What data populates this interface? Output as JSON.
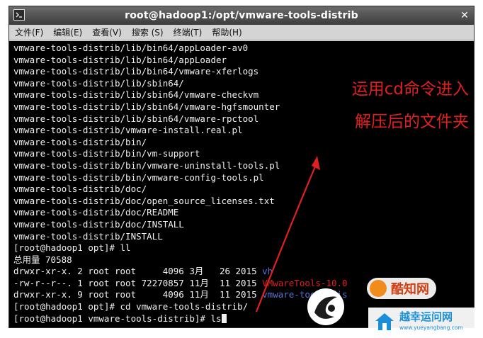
{
  "window": {
    "title": "root@hadoop1:/opt/vmware-tools-distrib",
    "close_glyph": "✕"
  },
  "menu": {
    "items": [
      {
        "label": "文件(F)"
      },
      {
        "label": "编辑(E)"
      },
      {
        "label": "查看(V)"
      },
      {
        "label": "搜索 (S)"
      },
      {
        "label": "终端(T)"
      },
      {
        "label": "帮助(H)"
      }
    ]
  },
  "terminal": {
    "lines": [
      "vmware-tools-distrib/lib/bin64/appLoader-av0",
      "vmware-tools-distrib/lib/bin64/appLoader",
      "vmware-tools-distrib/lib/bin64/vmware-xferlogs",
      "vmware-tools-distrib/lib/sbin64/",
      "vmware-tools-distrib/lib/sbin64/vmware-checkvm",
      "vmware-tools-distrib/lib/sbin64/vmware-hgfsmounter",
      "vmware-tools-distrib/lib/sbin64/vmware-rpctool",
      "vmware-tools-distrib/vmware-install.real.pl",
      "vmware-tools-distrib/bin/",
      "vmware-tools-distrib/bin/vm-support",
      "vmware-tools-distrib/bin/vmware-uninstall-tools.pl",
      "vmware-tools-distrib/bin/vmware-config-tools.pl",
      "vmware-tools-distrib/doc/",
      "vmware-tools-distrib/doc/open_source_licenses.txt",
      "vmware-tools-distrib/doc/README",
      "vmware-tools-distrib/doc/INSTALL",
      "vmware-tools-distrib/INSTALL",
      "[root@hadoop1 opt]# ll",
      "总用量 70588"
    ],
    "listing": [
      {
        "prefix": "drwxr-xr-x. 2 root root     4096 3月   26 2015 ",
        "name": "vh",
        "color": "blue"
      },
      {
        "prefix": "-rw-r--r--. 1 root root 72270857 11月  11 2015 ",
        "name": "VMwareTools-10.0",
        "color": "red"
      },
      {
        "prefix": "drwxr-xr-x. 9 root root     4096 11月  11 2015 ",
        "name": "vmware-tools-dis",
        "color": "blue"
      }
    ],
    "cmd_cd": "[root@hadoop1 opt]# cd vmware-tools-distrib/",
    "prompt_ls": "[root@hadoop1 vmware-tools-distrib]# ls"
  },
  "annotation": {
    "line1": "运用cd命令进入",
    "line2": "解压后的文件夹",
    "color": "#e02020"
  },
  "watermark": {
    "badge_text": "酷知网",
    "site_name": "越幸运问网",
    "site_url": "www.yueyangbang.com"
  },
  "colors": {
    "terminal_bg": "#000000",
    "terminal_fg": "#f2f2f2",
    "dir_blue": "#5a73d8",
    "archive_red": "#e02020"
  }
}
